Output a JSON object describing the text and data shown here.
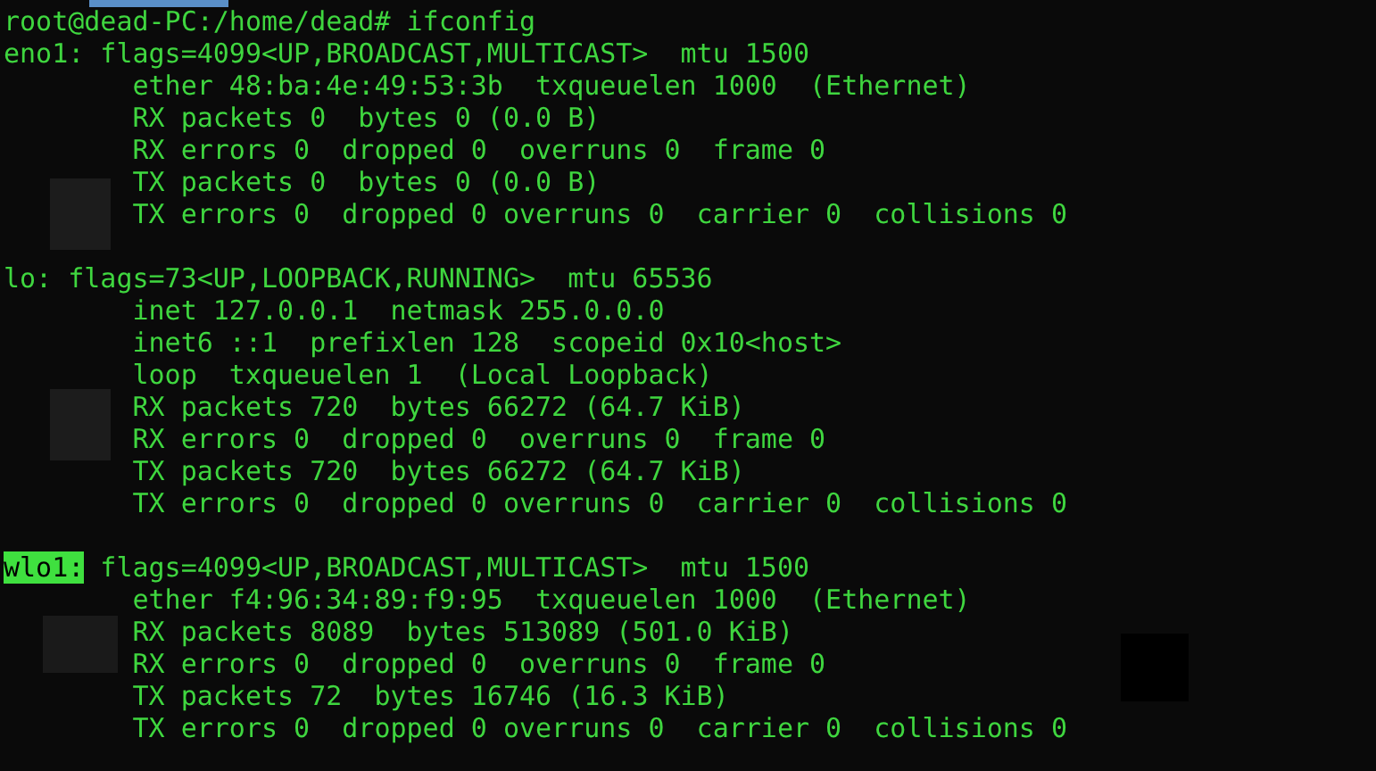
{
  "prompt": "root@dead-PC:/home/dead#",
  "command": "ifconfig",
  "interfaces": [
    {
      "name": "eno1:",
      "highlighted": false,
      "header": "flags=4099<UP,BROADCAST,MULTICAST>  mtu 1500",
      "lines": [
        "ether 48:ba:4e:49:53:3b  txqueuelen 1000  (Ethernet)",
        "RX packets 0  bytes 0 (0.0 B)",
        "RX errors 0  dropped 0  overruns 0  frame 0",
        "TX packets 0  bytes 0 (0.0 B)",
        "TX errors 0  dropped 0 overruns 0  carrier 0  collisions 0"
      ]
    },
    {
      "name": "lo:",
      "highlighted": false,
      "header": "flags=73<UP,LOOPBACK,RUNNING>  mtu 65536",
      "lines": [
        "inet 127.0.0.1  netmask 255.0.0.0",
        "inet6 ::1  prefixlen 128  scopeid 0x10<host>",
        "loop  txqueuelen 1  (Local Loopback)",
        "RX packets 720  bytes 66272 (64.7 KiB)",
        "RX errors 0  dropped 0  overruns 0  frame 0",
        "TX packets 720  bytes 66272 (64.7 KiB)",
        "TX errors 0  dropped 0 overruns 0  carrier 0  collisions 0"
      ]
    },
    {
      "name": "wlo1:",
      "highlighted": true,
      "header": "flags=4099<UP,BROADCAST,MULTICAST>  mtu 1500",
      "lines": [
        "ether f4:96:34:89:f9:95  txqueuelen 1000  (Ethernet)",
        "RX packets 8089  bytes 513089 (501.0 KiB)",
        "RX errors 0  dropped 0  overruns 0  frame 0",
        "TX packets 72  bytes 16746 (16.3 KiB)",
        "TX errors 0  dropped 0 overruns 0  carrier 0  collisions 0"
      ]
    }
  ]
}
